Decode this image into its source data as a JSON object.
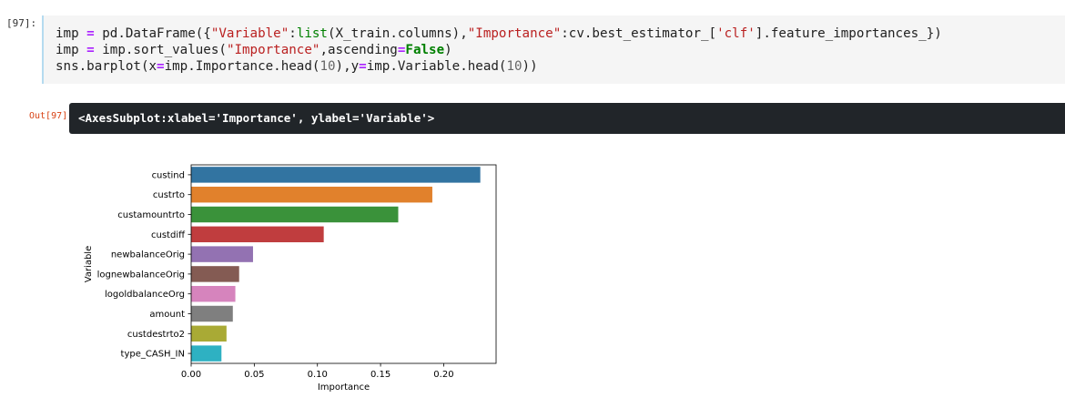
{
  "input_cell": {
    "prompt": "[97]:",
    "lines": [
      [
        [
          "imp ",
          ""
        ],
        [
          "=",
          "op"
        ],
        [
          " pd.DataFrame({",
          ""
        ],
        [
          "\"Variable\"",
          "str"
        ],
        [
          ":",
          ""
        ],
        [
          "list",
          "bi"
        ],
        [
          "(X_train.columns),",
          ""
        ],
        [
          "\"Importance\"",
          "str"
        ],
        [
          ":cv.best_estimator_[",
          ""
        ],
        [
          "'clf'",
          "str"
        ],
        [
          "].feature_importances_})",
          ""
        ]
      ],
      [
        [
          "imp ",
          ""
        ],
        [
          "=",
          "op"
        ],
        [
          " imp.sort_values(",
          ""
        ],
        [
          "\"Importance\"",
          "str"
        ],
        [
          ",ascending",
          ""
        ],
        [
          "=",
          "op"
        ],
        [
          "False",
          "kw"
        ],
        [
          ")",
          ""
        ]
      ],
      [
        [
          "sns.barplot(x",
          ""
        ],
        [
          "=",
          "op"
        ],
        [
          "imp.Importance.head(",
          ""
        ],
        [
          "10",
          "num"
        ],
        [
          "),y",
          ""
        ],
        [
          "=",
          "op"
        ],
        [
          "imp.Variable.head(",
          ""
        ],
        [
          "10",
          "num"
        ],
        [
          "))",
          ""
        ]
      ]
    ]
  },
  "output_cell": {
    "prompt": "Out[97]",
    "text": "<AxesSubplot:xlabel='Importance', ylabel='Variable'>"
  },
  "chart_data": {
    "type": "bar",
    "orientation": "horizontal",
    "categories": [
      "custind",
      "custrto",
      "custamountrto",
      "custdiff",
      "newbalanceOrig",
      "lognewbalanceOrig",
      "logoldbalanceOrg",
      "amount",
      "custdestrto2",
      "type_CASH_IN"
    ],
    "values": [
      0.229,
      0.191,
      0.164,
      0.105,
      0.049,
      0.038,
      0.035,
      0.033,
      0.028,
      0.024
    ],
    "colors": [
      "#3274a1",
      "#e1812c",
      "#3a923a",
      "#c03d3e",
      "#9372b2",
      "#845b53",
      "#d684bd",
      "#7f7f7f",
      "#a9aa35",
      "#2eb1c2"
    ],
    "xlabel": "Importance",
    "ylabel": "Variable",
    "xlim": [
      0,
      0.2415
    ],
    "xticks": [
      0.0,
      0.05,
      0.1,
      0.15,
      0.2
    ],
    "xtick_labels": [
      "0.00",
      "0.05",
      "0.10",
      "0.15",
      "0.20"
    ],
    "grid": false
  }
}
